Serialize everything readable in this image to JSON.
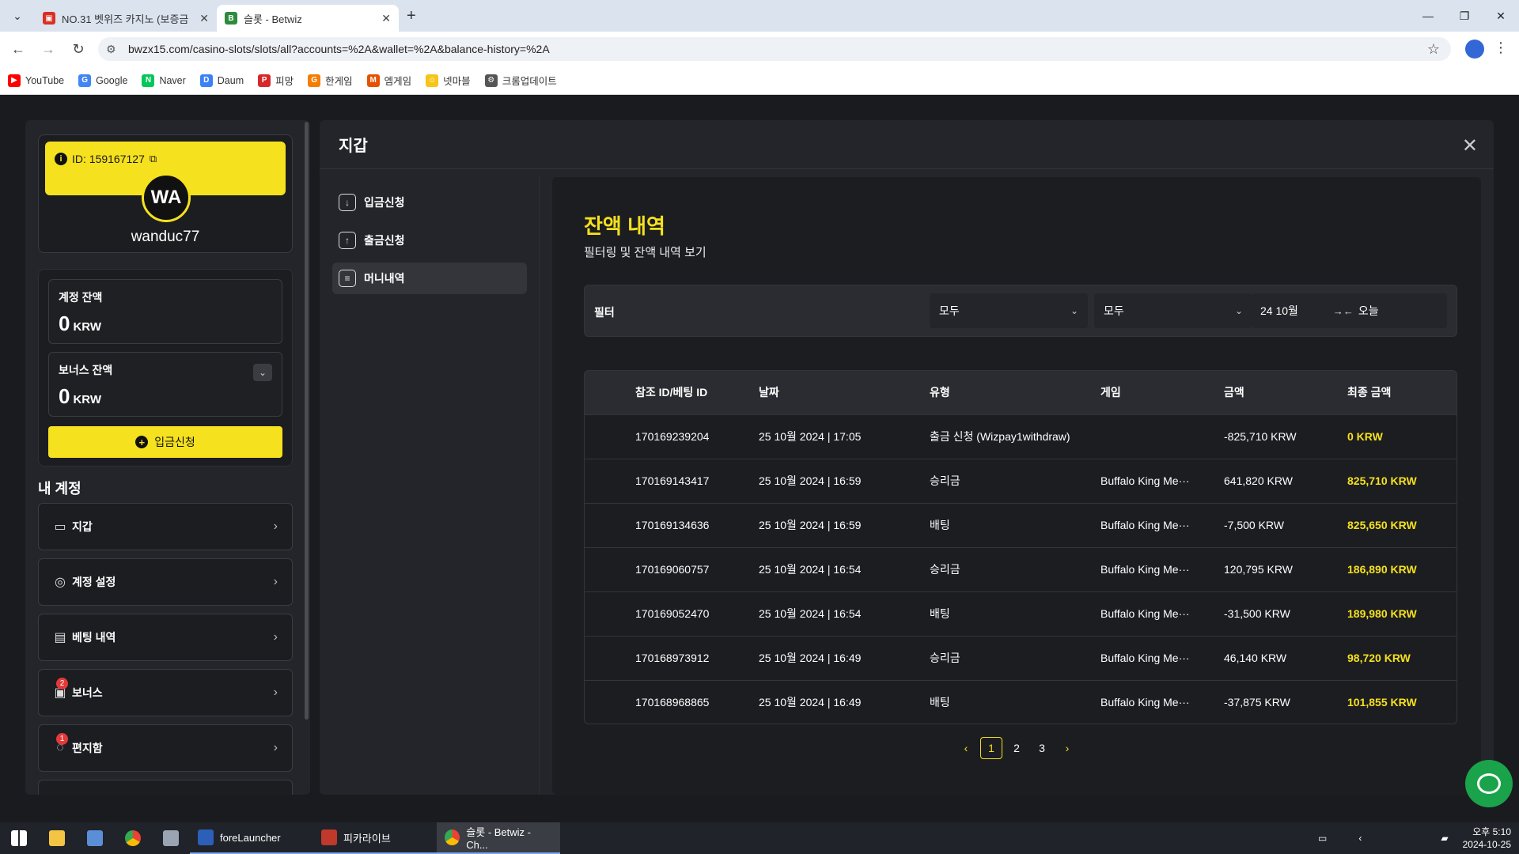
{
  "browser": {
    "tabs": [
      {
        "title": "NO.31 벳위즈 카지노 (보증금",
        "active": false,
        "favicon_color": "#d93025"
      },
      {
        "title": "슬롯 - Betwiz",
        "active": true,
        "favicon_color": "#2e8b3d"
      }
    ],
    "url": "bwzx15.com/casino-slots/slots/all?accounts=%2A&wallet=%2A&balance-history=%2A",
    "bookmarks": [
      {
        "label": "YouTube",
        "color": "#ff0000"
      },
      {
        "label": "Google",
        "color": "#4285f4"
      },
      {
        "label": "Naver",
        "color": "#03c75a"
      },
      {
        "label": "Daum",
        "color": "#3b82f6"
      },
      {
        "label": "피망",
        "color": "#d62828"
      },
      {
        "label": "한게임",
        "color": "#f57c00"
      },
      {
        "label": "엠게임",
        "color": "#e65100"
      },
      {
        "label": "넷마블",
        "color": "#f5c518"
      },
      {
        "label": "크롬업데이트",
        "color": "#555555"
      }
    ]
  },
  "profile": {
    "id_text": "ID: 159167127",
    "initials": "WA",
    "username": "wanduc77"
  },
  "balances": {
    "account_label": "계정 잔액",
    "account_amount": "0",
    "bonus_label": "보너스 잔액",
    "bonus_amount": "0",
    "currency": "KRW",
    "deposit_button": "입금신청"
  },
  "account_menu": {
    "title": "내 계정",
    "items": [
      {
        "label": "지갑",
        "badge": ""
      },
      {
        "label": "계정 설정",
        "badge": ""
      },
      {
        "label": "베팅 내역",
        "badge": ""
      },
      {
        "label": "보너스",
        "badge": "2"
      },
      {
        "label": "편지함",
        "badge": "1"
      }
    ]
  },
  "wallet": {
    "title": "지갑",
    "subnav": [
      {
        "label": "입금신청",
        "active": false
      },
      {
        "label": "출금신청",
        "active": false
      },
      {
        "label": "머니내역",
        "active": true
      }
    ],
    "heading": "잔액 내역",
    "subheading": "필터링 및 잔액 내역 보기",
    "filter": {
      "label": "필터",
      "select1": "모두",
      "select2": "모두",
      "date_from": "24 10월",
      "date_to": "오늘"
    },
    "table": {
      "headers": [
        "참조 ID/베팅 ID",
        "날짜",
        "유형",
        "게임",
        "금액",
        "최종 금액"
      ],
      "rows": [
        [
          "170169239204",
          "25 10월 2024 | 17:05",
          "출금 신청 (Wizpay1withdraw)",
          "",
          "-825,710 KRW",
          "0 KRW"
        ],
        [
          "170169143417",
          "25 10월 2024 | 16:59",
          "승리금",
          "Buffalo King Me···",
          "641,820 KRW",
          "825,710 KRW"
        ],
        [
          "170169134636",
          "25 10월 2024 | 16:59",
          "배팅",
          "Buffalo King Me···",
          "-7,500 KRW",
          "825,650 KRW"
        ],
        [
          "170169060757",
          "25 10월 2024 | 16:54",
          "승리금",
          "Buffalo King Me···",
          "120,795 KRW",
          "186,890 KRW"
        ],
        [
          "170169052470",
          "25 10월 2024 | 16:54",
          "배팅",
          "Buffalo King Me···",
          "-31,500 KRW",
          "189,980 KRW"
        ],
        [
          "170168973912",
          "25 10월 2024 | 16:49",
          "승리금",
          "Buffalo King Me···",
          "46,140 KRW",
          "98,720 KRW"
        ],
        [
          "170168968865",
          "25 10월 2024 | 16:49",
          "배팅",
          "Buffalo King Me···",
          "-37,875 KRW",
          "101,855 KRW"
        ]
      ]
    },
    "pagination": {
      "pages": [
        "1",
        "2",
        "3"
      ],
      "current": "1"
    }
  },
  "taskbar": {
    "apps": [
      {
        "label": "foreLauncher",
        "active": false
      },
      {
        "label": "피카라이브",
        "active": false
      },
      {
        "label": "슬롯 - Betwiz - Ch...",
        "active": true
      }
    ],
    "time": "오후 5:10",
    "date": "2024-10-25"
  },
  "colors": {
    "accent": "#f5e11e",
    "chat": "#1aa34a"
  }
}
